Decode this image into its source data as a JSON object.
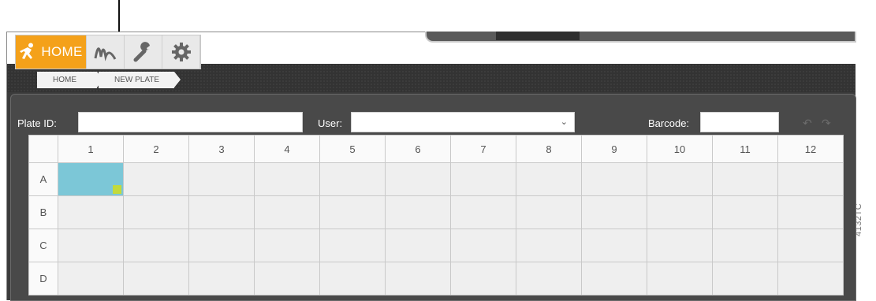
{
  "nav": {
    "tabs": [
      {
        "id": "home",
        "label": "HOME",
        "icon": "running-person-icon",
        "active": true
      },
      {
        "id": "analysis",
        "icon": "waveform-icon"
      },
      {
        "id": "tools",
        "icon": "wrench-icon"
      },
      {
        "id": "settings",
        "icon": "gear-icon"
      }
    ],
    "active_color": "#f4a11a"
  },
  "breadcrumb": [
    "HOME",
    "NEW PLATE"
  ],
  "toolbar": {
    "plate_id_label": "Plate ID:",
    "plate_id_value": "",
    "user_label": "User:",
    "user_value": "",
    "barcode_label": "Barcode:",
    "barcode_value": ""
  },
  "plate": {
    "columns": [
      "1",
      "2",
      "3",
      "4",
      "5",
      "6",
      "7",
      "8",
      "9",
      "10",
      "11",
      "12"
    ],
    "rows": [
      "A",
      "B",
      "C",
      "D"
    ],
    "selected_well": "A1",
    "selected_color": "#7cc7d7",
    "handle_color": "#c3da3c"
  },
  "figure_id": "4132TC"
}
